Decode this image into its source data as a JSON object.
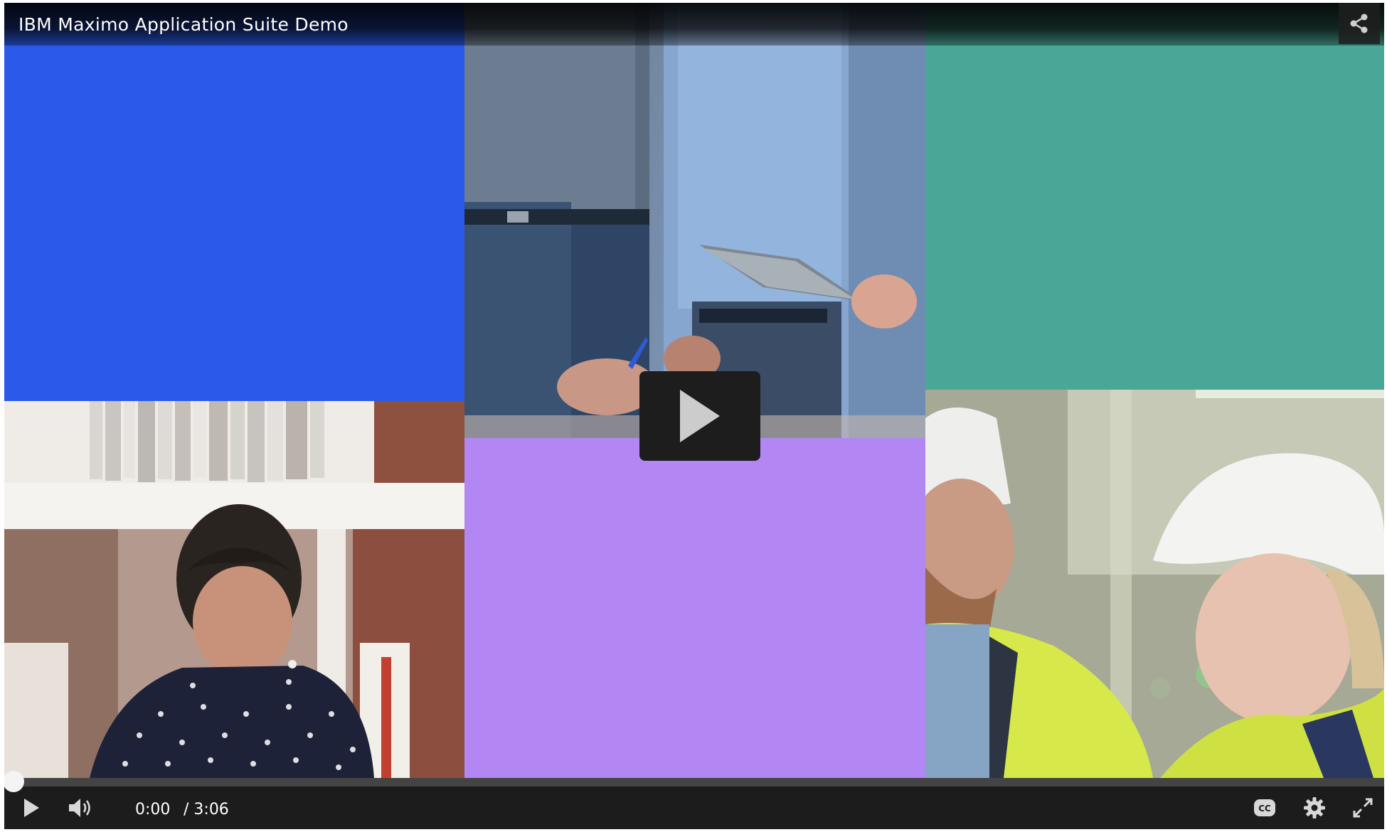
{
  "player": {
    "title": "IBM Maximo Application Suite Demo",
    "current_time": "0:00",
    "duration": "/ 3:06",
    "progress": 0.0,
    "icons": {
      "share": "share-icon",
      "big_play": "play-icon",
      "play": "play-icon",
      "volume": "volume-icon",
      "captions": "closed-captions-icon",
      "settings": "gear-icon",
      "fullscreen": "fullscreen-icon"
    }
  },
  "colors": {
    "tile_blue": "#2b59ea",
    "tile_purple": "#b287f4",
    "tile_teal": "#4aa797",
    "control_bar": "#1c1c1c"
  }
}
